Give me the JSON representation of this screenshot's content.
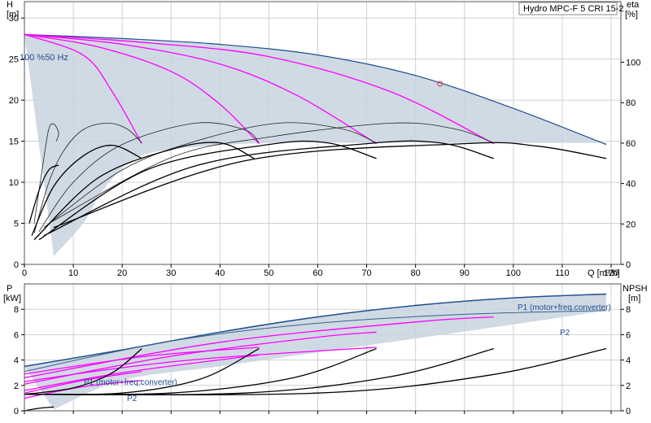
{
  "colors": {
    "envelope_fill": "#c8d4e0",
    "envelope_edge": "#1f4e8c",
    "system_curve": "#ff00ff",
    "curve": "#000000",
    "grid": "#d0d0d0"
  },
  "chart_data": [
    {
      "type": "line",
      "title": "Hydro MPC-F 5 CRI 15-2",
      "xlabel": "Q [m³/h]",
      "x_unit": "m³/h",
      "ylabel": "H",
      "y_unit": "[m]",
      "y2label": "eta",
      "y2_unit": "[%]",
      "xlim": [
        0,
        122
      ],
      "ylim": [
        0,
        32
      ],
      "y2lim": [
        0,
        130
      ],
      "x_ticks": [
        0,
        10,
        20,
        30,
        40,
        50,
        60,
        70,
        80,
        90,
        100,
        110,
        120
      ],
      "y_ticks": [
        0,
        5,
        10,
        15,
        20,
        25,
        30
      ],
      "y2_ticks": [
        0,
        20,
        40,
        60,
        80,
        100
      ],
      "grid": true,
      "annotation": "100 %50 Hz",
      "duty_point": {
        "x": 85,
        "y": 22
      },
      "envelope": {
        "upper": [
          [
            0,
            28
          ],
          [
            20,
            27.5
          ],
          [
            40,
            26.8
          ],
          [
            60,
            25.5
          ],
          [
            80,
            23
          ],
          [
            100,
            19
          ],
          [
            119,
            14.6
          ]
        ],
        "lower": [
          [
            6,
            1
          ],
          [
            12,
            5
          ],
          [
            16,
            9
          ],
          [
            22,
            12.6
          ],
          [
            30,
            14
          ],
          [
            50,
            14.8
          ],
          [
            70,
            14.8
          ],
          [
            90,
            14.8
          ],
          [
            119,
            14.8
          ]
        ],
        "left": [
          [
            0,
            28
          ],
          [
            0,
            0
          ],
          [
            6,
            1
          ]
        ]
      },
      "series": [
        {
          "name": "",
          "kind": "system",
          "values": [
            [
              0,
              28
            ],
            [
              12,
              25.5
            ],
            [
              18,
              21
            ],
            [
              24,
              14.7
            ]
          ]
        },
        {
          "name": "",
          "kind": "system",
          "values": [
            [
              0,
              28
            ],
            [
              15,
              26.5
            ],
            [
              30,
              23.5
            ],
            [
              40,
              19.5
            ],
            [
              48,
              14.7
            ]
          ]
        },
        {
          "name": "",
          "kind": "system",
          "values": [
            [
              0,
              28
            ],
            [
              20,
              26.8
            ],
            [
              40,
              24.4
            ],
            [
              56,
              20.5
            ],
            [
              72,
              14.7
            ]
          ]
        },
        {
          "name": "",
          "kind": "system",
          "values": [
            [
              0,
              28
            ],
            [
              25,
              27
            ],
            [
              50,
              25.3
            ],
            [
              75,
              21
            ],
            [
              96,
              14.7
            ]
          ]
        },
        {
          "name": "",
          "kind": "eta",
          "values": [
            [
              2,
              5
            ],
            [
              4,
              13
            ],
            [
              5,
              16.5
            ],
            [
              6,
              17.1
            ],
            [
              7,
              16
            ],
            [
              6.5,
              15
            ]
          ]
        },
        {
          "name": "",
          "kind": "eta",
          "values": [
            [
              2,
              3.8
            ],
            [
              5,
              10
            ],
            [
              8,
              13.8
            ],
            [
              12,
              16.4
            ],
            [
              17,
              17.2
            ],
            [
              21,
              16.5
            ],
            [
              24,
              14.8
            ]
          ]
        },
        {
          "name": "",
          "kind": "eta",
          "values": [
            [
              3,
              4
            ],
            [
              10,
              10
            ],
            [
              20,
              14.6
            ],
            [
              35,
              17.2
            ],
            [
              45,
              16.4
            ],
            [
              48,
              14.8
            ]
          ]
        },
        {
          "name": "",
          "kind": "eta",
          "values": [
            [
              4,
              4.5
            ],
            [
              20,
              11.5
            ],
            [
              35,
              15
            ],
            [
              52,
              17.2
            ],
            [
              65,
              16.5
            ],
            [
              72,
              14.8
            ]
          ]
        },
        {
          "name": "",
          "kind": "eta",
          "values": [
            [
              5,
              5
            ],
            [
              30,
              13
            ],
            [
              50,
              15.5
            ],
            [
              75,
              17.2
            ],
            [
              88,
              16.5
            ],
            [
              96,
              14.8
            ]
          ]
        },
        {
          "name": "",
          "kind": "curve",
          "values": [
            [
              1,
              5
            ],
            [
              3,
              9
            ],
            [
              5,
              11.5
            ],
            [
              7,
              12.1
            ]
          ]
        },
        {
          "name": "",
          "kind": "curve",
          "values": [
            [
              1.5,
              3.5
            ],
            [
              6,
              9.5
            ],
            [
              12,
              13.2
            ],
            [
              18,
              14.5
            ],
            [
              24,
              12.9
            ]
          ]
        },
        {
          "name": "",
          "kind": "curve",
          "values": [
            [
              2,
              3
            ],
            [
              15,
              10.5
            ],
            [
              30,
              14
            ],
            [
              40,
              14.8
            ],
            [
              47,
              12.9
            ]
          ]
        },
        {
          "name": "",
          "kind": "curve",
          "values": [
            [
              3,
              3
            ],
            [
              25,
              11.5
            ],
            [
              50,
              14.6
            ],
            [
              62,
              14.8
            ],
            [
              72,
              12.9
            ]
          ]
        },
        {
          "name": "",
          "kind": "curve",
          "values": [
            [
              4,
              3.5
            ],
            [
              35,
              12
            ],
            [
              70,
              14.7
            ],
            [
              85,
              14.8
            ],
            [
              96,
              12.9
            ]
          ]
        },
        {
          "name": "",
          "kind": "curve",
          "values": [
            [
              6,
              4.5
            ],
            [
              45,
              12.6
            ],
            [
              90,
              14.7
            ],
            [
              105,
              14.4
            ],
            [
              119,
              12.9
            ]
          ]
        }
      ]
    },
    {
      "type": "line",
      "ylabel": "P",
      "y_unit": "[kW]",
      "y2label": "NPSH",
      "y2_unit": "[m]",
      "xlim": [
        0,
        122
      ],
      "ylim": [
        0,
        10
      ],
      "y2lim": [
        0,
        10
      ],
      "y_ticks": [
        0,
        2,
        4,
        6,
        8
      ],
      "y2_ticks": [
        0,
        2,
        4,
        6,
        8
      ],
      "grid": true,
      "labels": [
        {
          "text": "P1 (motor+freq.converter)",
          "x": 107,
          "y": 9.6
        },
        {
          "text": "P2",
          "x": 118,
          "y": 7.6
        },
        {
          "text": "P1 (motor+freq.converter)",
          "x": 14,
          "y": 2.6
        },
        {
          "text": "P2",
          "x": 23,
          "y": 0.9
        }
      ],
      "envelope": {
        "upper": [
          [
            0,
            3.5
          ],
          [
            20,
            4.8
          ],
          [
            40,
            6.2
          ],
          [
            60,
            7.4
          ],
          [
            80,
            8.3
          ],
          [
            100,
            8.9
          ],
          [
            119,
            9.2
          ]
        ],
        "lower": [
          [
            6,
            0.1
          ],
          [
            20,
            2.4
          ],
          [
            40,
            3.5
          ],
          [
            60,
            4.6
          ],
          [
            80,
            5.7
          ],
          [
            100,
            6.8
          ],
          [
            119,
            7.9
          ]
        ]
      },
      "series": [
        {
          "name": "P1 (motor+freq.converter)",
          "kind": "p1",
          "values": [
            [
              0,
              3.5
            ],
            [
              20,
              4.8
            ],
            [
              40,
              6.2
            ],
            [
              60,
              7.4
            ],
            [
              80,
              8.3
            ],
            [
              100,
              8.9
            ],
            [
              119,
              9.2
            ]
          ]
        },
        {
          "name": "P2",
          "kind": "p2",
          "values": [
            [
              0,
              3.1
            ],
            [
              30,
              5.5
            ],
            [
              60,
              6.9
            ],
            [
              90,
              7.6
            ],
            [
              119,
              7.9
            ]
          ]
        },
        {
          "name": "",
          "kind": "system",
          "values": [
            [
              0,
              2.6
            ],
            [
              40,
              5.4
            ],
            [
              80,
              7.0
            ],
            [
              96,
              7.4
            ]
          ]
        },
        {
          "name": "",
          "kind": "system",
          "values": [
            [
              0,
              2.1
            ],
            [
              30,
              4.3
            ],
            [
              60,
              5.8
            ],
            [
              72,
              6.2
            ]
          ]
        },
        {
          "name": "",
          "kind": "system",
          "values": [
            [
              0,
              1.6
            ],
            [
              20,
              3.0
            ],
            [
              48,
              4.4
            ]
          ]
        },
        {
          "name": "",
          "kind": "system",
          "values": [
            [
              0,
              1.0
            ],
            [
              12,
              1.9
            ],
            [
              24,
              2.4
            ]
          ]
        },
        {
          "name": "",
          "kind": "system",
          "values": [
            [
              0,
              2.9
            ],
            [
              25,
              4.3
            ],
            [
              48,
              5.0
            ]
          ]
        },
        {
          "name": "",
          "kind": "system",
          "values": [
            [
              0,
              2.3
            ],
            [
              20,
              3.4
            ],
            [
              40,
              4.2
            ],
            [
              72,
              5.0
            ]
          ]
        },
        {
          "name": "",
          "kind": "system",
          "values": [
            [
              0,
              1.4
            ],
            [
              12,
              2.4
            ],
            [
              24,
              3.1
            ]
          ]
        },
        {
          "name": "",
          "kind": "curve",
          "values": [
            [
              0,
              1.3
            ],
            [
              10,
              1.8
            ],
            [
              18,
              3.0
            ],
            [
              24,
              4.9
            ]
          ]
        },
        {
          "name": "",
          "kind": "curve",
          "values": [
            [
              0,
              1.3
            ],
            [
              20,
              1.4
            ],
            [
              36,
              2.5
            ],
            [
              48,
              4.9
            ]
          ]
        },
        {
          "name": "",
          "kind": "curve",
          "values": [
            [
              0,
              1.3
            ],
            [
              30,
              1.4
            ],
            [
              55,
              2.6
            ],
            [
              72,
              4.9
            ]
          ]
        },
        {
          "name": "",
          "kind": "curve",
          "values": [
            [
              0,
              1.3
            ],
            [
              45,
              1.4
            ],
            [
              75,
              2.7
            ],
            [
              96,
              4.9
            ]
          ]
        },
        {
          "name": "",
          "kind": "curve",
          "values": [
            [
              0,
              1.3
            ],
            [
              60,
              1.4
            ],
            [
              95,
              2.8
            ],
            [
              119,
              4.9
            ]
          ]
        },
        {
          "name": "",
          "kind": "curve",
          "values": [
            [
              0,
              0
            ],
            [
              3,
              0.2
            ],
            [
              6,
              0.3
            ]
          ]
        }
      ]
    }
  ]
}
